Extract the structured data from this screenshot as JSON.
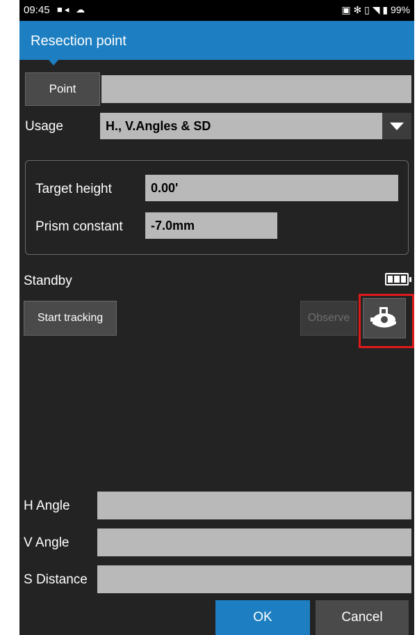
{
  "status_bar": {
    "time": "09:45",
    "battery_pct": "99%"
  },
  "app_bar": {
    "title": "Resection point"
  },
  "point": {
    "button_label": "Point",
    "value": ""
  },
  "usage": {
    "label": "Usage",
    "value": "H., V.Angles & SD"
  },
  "target": {
    "height_label": "Target height",
    "height_value": "0.00'",
    "prism_label": "Prism constant",
    "prism_value": "-7.0mm"
  },
  "standby": {
    "label": "Standby",
    "battery_level": "3 of 3 bars"
  },
  "actions": {
    "start_tracking": "Start tracking",
    "observe": "Observe"
  },
  "measurements": {
    "h_angle_label": "H Angle",
    "h_angle_value": "",
    "v_angle_label": "V Angle",
    "v_angle_value": "",
    "s_distance_label": "S Distance",
    "s_distance_value": ""
  },
  "footer": {
    "ok": "OK",
    "cancel": "Cancel"
  },
  "colors": {
    "app_bar": "#1d7fc1",
    "background": "#232323",
    "field": "#b9b9b9",
    "highlight": "#e0191b"
  }
}
